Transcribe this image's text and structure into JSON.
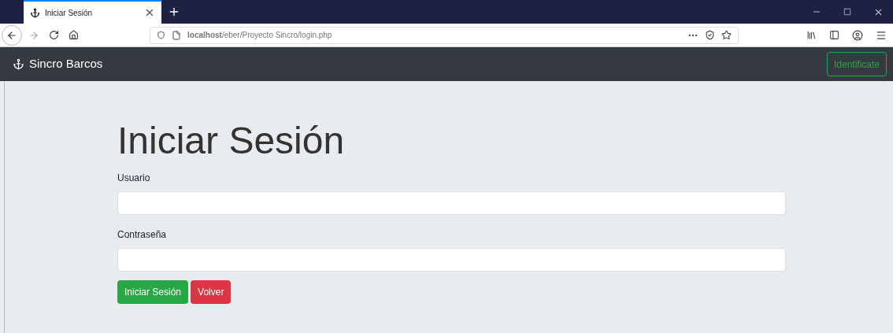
{
  "browser": {
    "tab": {
      "title": "Iniciar Sesión",
      "selected": true
    },
    "url": "**localhost**/eber/Proyecto Sincro/login.php"
  },
  "navbar": {
    "brand": "Sincro Barcos",
    "button": "Identificate"
  },
  "form": {
    "heading": "Iniciar Sesión",
    "fields": [
      {
        "label": "Usuario"
      },
      {
        "label": "Contraseña"
      }
    ],
    "buttons": [
      {
        "label": "Iniciar Sesión",
        "kind": "success"
      },
      {
        "label": "Volver",
        "kind": "danger"
      }
    ]
  }
}
